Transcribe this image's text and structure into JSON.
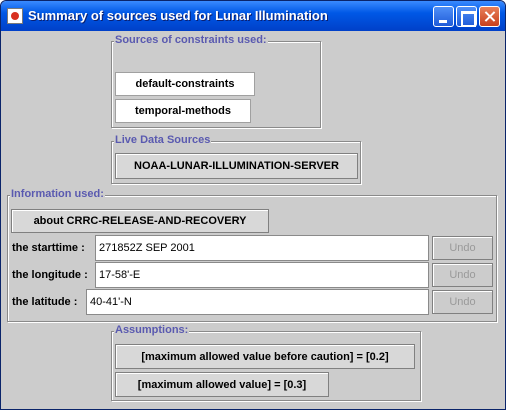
{
  "window": {
    "title": "Summary of sources used for Lunar Illumination"
  },
  "constraints": {
    "label": "Sources of constraints used:",
    "items": [
      "default-constraints",
      "temporal-methods"
    ]
  },
  "live": {
    "label": "Live Data Sources",
    "server": "NOAA-LUNAR-ILLUMINATION-SERVER"
  },
  "info": {
    "label": "Information used:",
    "about": "about CRRC-RELEASE-AND-RECOVERY",
    "rows": [
      {
        "label": "the starttime :",
        "value": "271852Z SEP 2001",
        "undo": "Undo"
      },
      {
        "label": "the longitude :",
        "value": "17-58'-E",
        "undo": "Undo"
      },
      {
        "label": "the latitude :",
        "value": "40-41'-N",
        "undo": "Undo"
      }
    ]
  },
  "assumptions": {
    "label": "Assumptions:",
    "items": [
      "[maximum allowed value before caution] = [0.2]",
      "[maximum allowed value] = [0.3]"
    ]
  }
}
